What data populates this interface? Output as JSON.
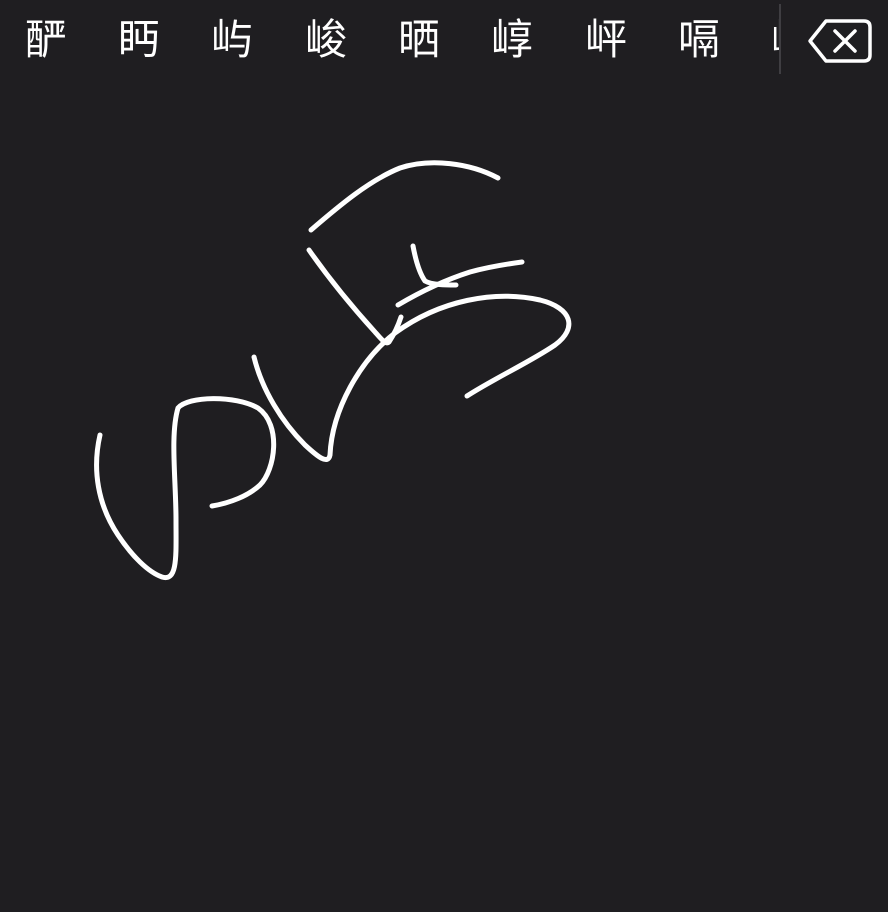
{
  "candidate_bar": {
    "candidates": [
      "酽",
      "眄",
      "屿",
      "峻",
      "晒",
      "崞",
      "岼",
      "嗝",
      "嵊"
    ]
  },
  "delete_button": {
    "icon": "backspace-icon"
  },
  "handwriting": {
    "stroke_color": "#ffffff",
    "background": "#1f1e21"
  }
}
